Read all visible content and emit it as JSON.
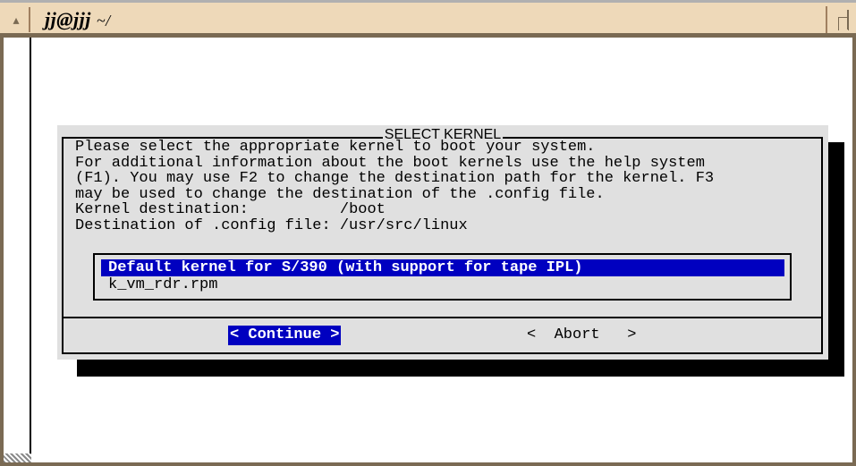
{
  "window": {
    "title": "jj@jjj",
    "path": "~/",
    "left_button_icon": "triangle-icon",
    "right_button_icon": "maximize-icon",
    "frame_color": "#7a6a53",
    "titlebar_color": "#eed9b9"
  },
  "dialog": {
    "title": "SELECT KERNEL",
    "description_lines": [
      "Please select the appropriate kernel to boot your system.",
      "For additional information about the boot kernels use the help system",
      "(F1). You may use F2 to change the destination path for the kernel. F3",
      "may be used to change the destination of the .config file."
    ],
    "kernel_destination_label": "Kernel destination:",
    "kernel_destination_value": "/boot",
    "config_destination_label": "Destination of .config file:",
    "config_destination_value": "/usr/src/linux",
    "kernels": [
      {
        "label": "Default kernel for S/390 (with support for tape IPL)",
        "selected": true
      },
      {
        "label": "k_vm_rdr.rpm",
        "selected": false
      }
    ],
    "buttons": {
      "continue": "< Continue >",
      "abort": "<  Abort   >"
    },
    "selection_color": "#0000c0"
  }
}
